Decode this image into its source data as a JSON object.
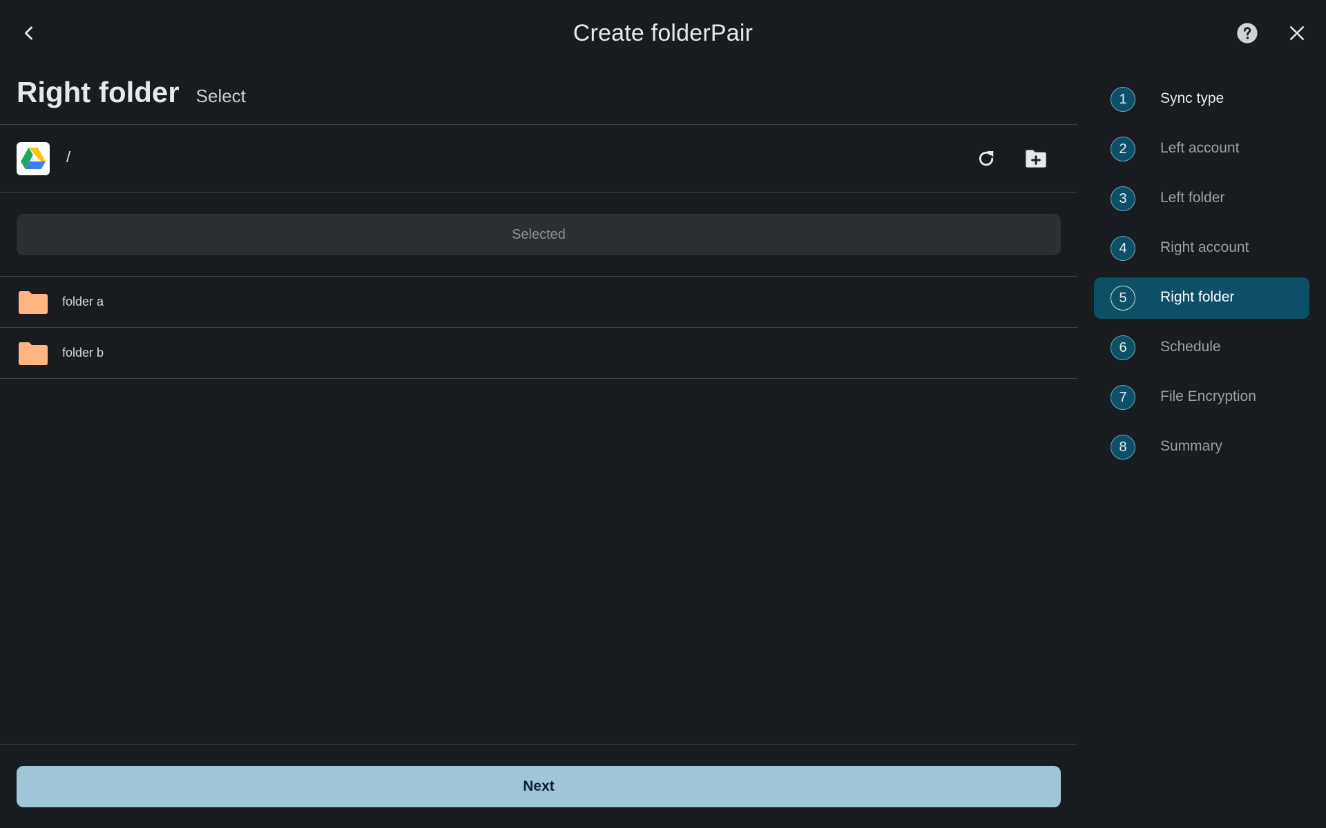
{
  "header": {
    "title": "Create folderPair",
    "back_icon": "chevron-left-icon",
    "help_icon": "help-circle-icon",
    "close_icon": "close-icon"
  },
  "page": {
    "heading": "Right folder",
    "subheading": "Select"
  },
  "browser": {
    "account_icon": "google-drive-icon",
    "path": "/",
    "refresh_icon": "refresh-icon",
    "new_folder_icon": "folder-plus-icon",
    "selected_label": "Selected",
    "folders": [
      {
        "name": "folder a"
      },
      {
        "name": "folder b"
      }
    ],
    "folder_color": "#ffb482"
  },
  "footer": {
    "next_label": "Next"
  },
  "steps": [
    {
      "number": "1",
      "label": "Sync type"
    },
    {
      "number": "2",
      "label": "Left account"
    },
    {
      "number": "3",
      "label": "Left folder"
    },
    {
      "number": "4",
      "label": "Right account"
    },
    {
      "number": "5",
      "label": "Right folder",
      "active": true
    },
    {
      "number": "6",
      "label": "Schedule"
    },
    {
      "number": "7",
      "label": "File Encryption"
    },
    {
      "number": "8",
      "label": "Summary"
    }
  ],
  "colors": {
    "background": "#181c20",
    "accent": "#0d4f66",
    "primary_button": "#9ec6d6"
  }
}
